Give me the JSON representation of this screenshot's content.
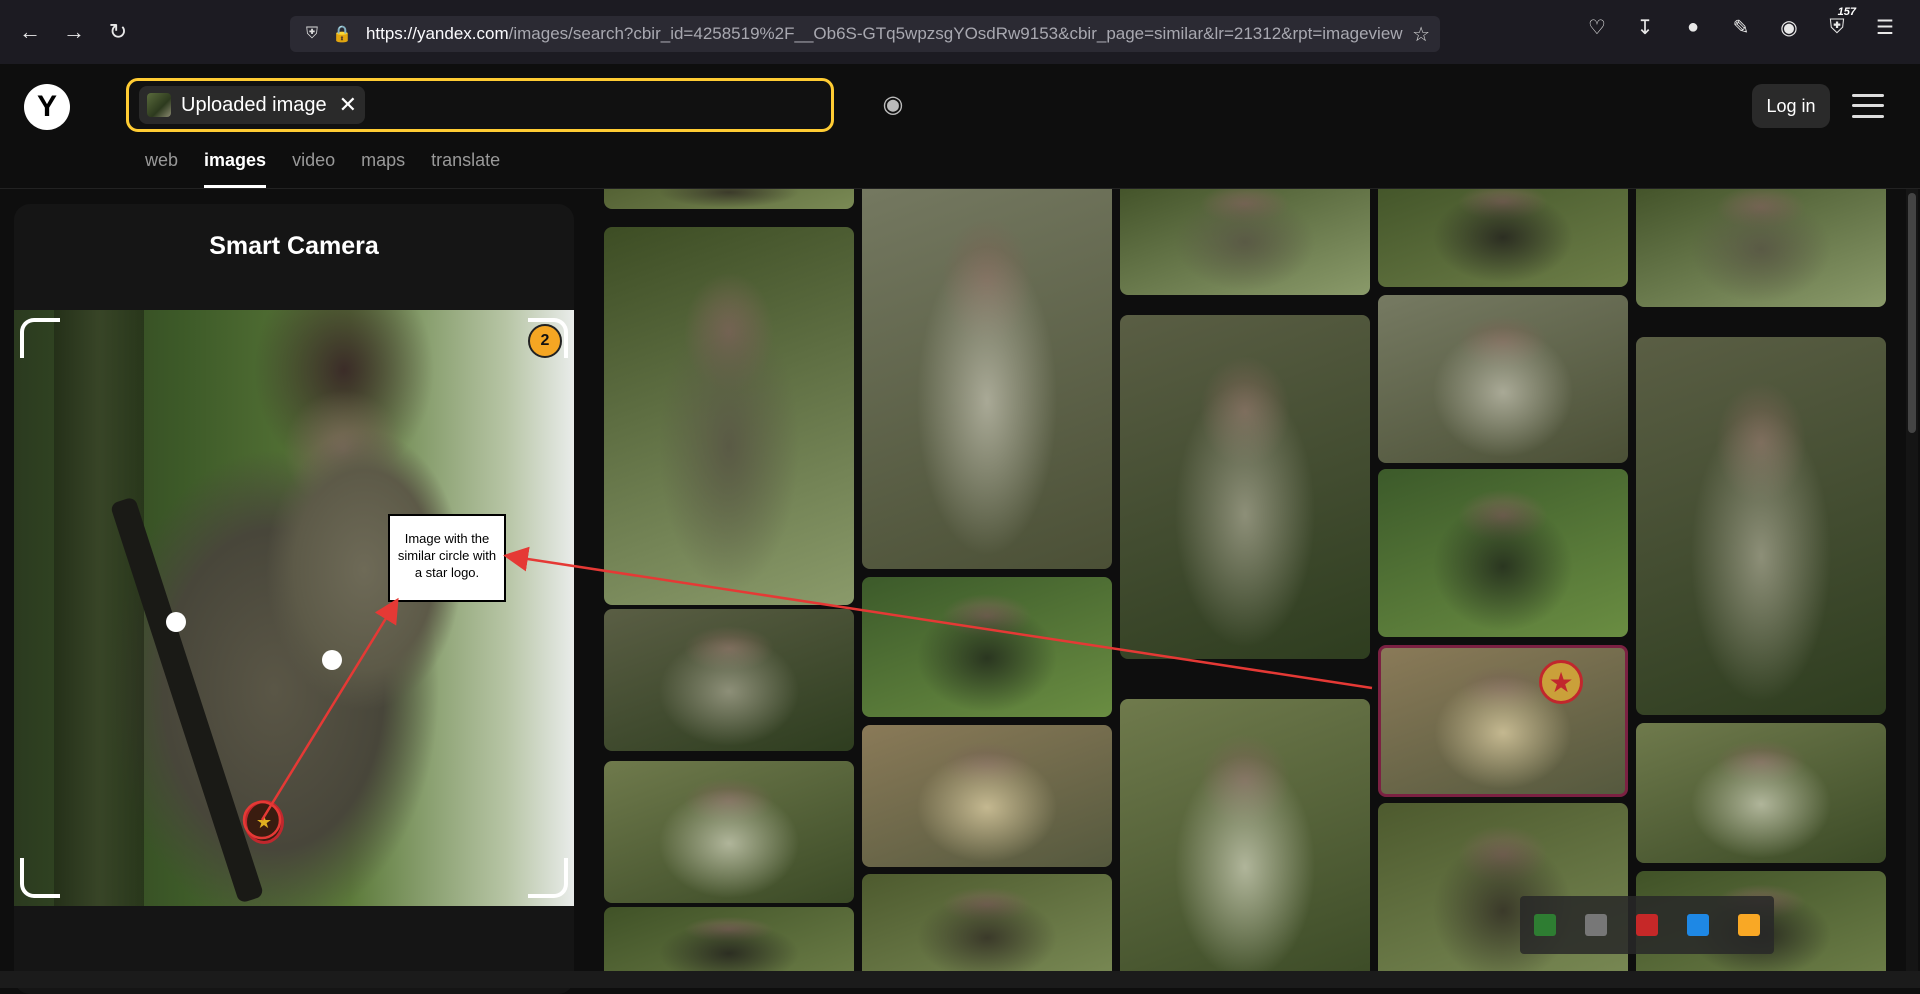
{
  "browser": {
    "url_main": "https://yandex.com",
    "url_rest": "/images/search?cbir_id=4258519%2F__Ob6S-GTq5wpzsgYOsdRw9153&cbir_page=similar&lr=21312&rpt=imageview",
    "extension_badge": "157"
  },
  "header": {
    "logo": "Y",
    "chip_label": "Uploaded image",
    "chip_close": "✕",
    "login_label": "Log in",
    "tabs": [
      "web",
      "images",
      "video",
      "maps",
      "translate"
    ],
    "active_tab": "images"
  },
  "smart_camera": {
    "title": "Smart Camera",
    "object_count": "2",
    "annotation": "Image with the similar circle with a star logo."
  },
  "colors": {
    "accent": "#ffcc33",
    "annotation_arrow": "#e53935",
    "selected_border": "#7b2142",
    "badge": "#f5a623"
  },
  "results": {
    "tile_count": 22,
    "selected_index": 15
  }
}
